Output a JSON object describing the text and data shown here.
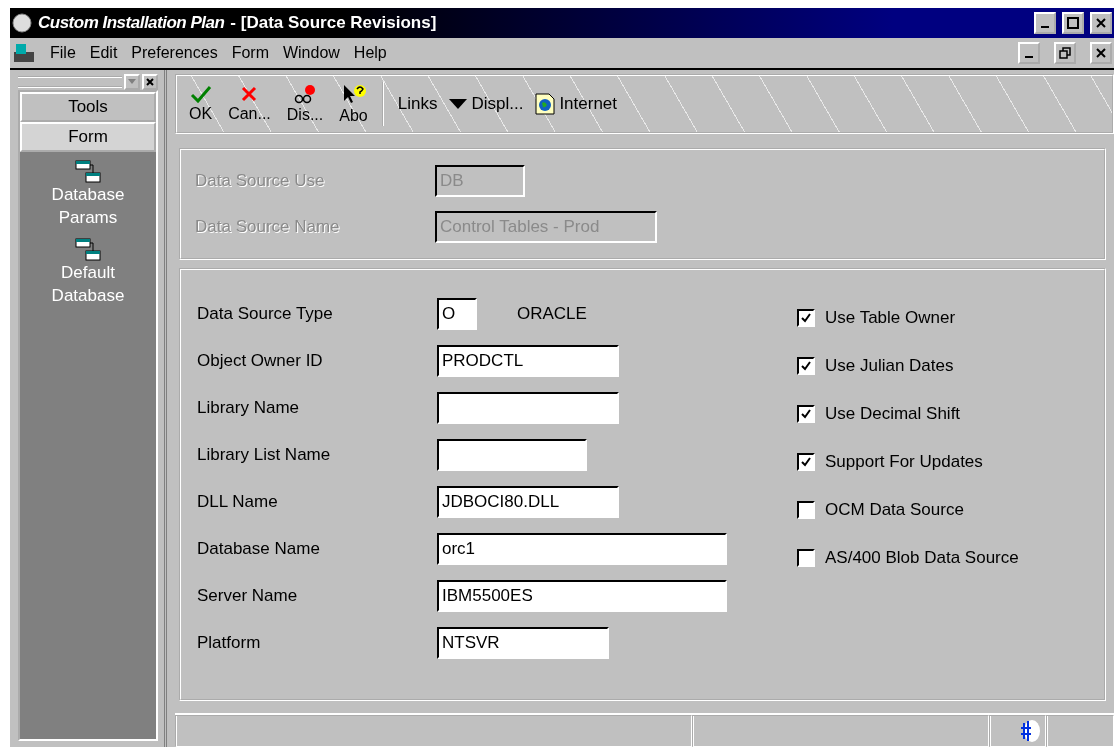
{
  "window": {
    "title_app": "Custom Installation Plan",
    "title_doc": "- [Data Source Revisions]"
  },
  "menu": [
    "File",
    "Edit",
    "Preferences",
    "Form",
    "Window",
    "Help"
  ],
  "sidebar": {
    "tabs": [
      {
        "label": "Tools",
        "selected": false
      },
      {
        "label": "Form",
        "selected": true
      }
    ],
    "items": [
      {
        "label": "Database Params"
      },
      {
        "label": "Default Database"
      }
    ]
  },
  "toolbar": {
    "buttons": [
      {
        "kind": "ok",
        "label": "OK"
      },
      {
        "kind": "cancel",
        "label": "Can..."
      },
      {
        "kind": "display",
        "label": "Dis..."
      },
      {
        "kind": "about",
        "label": "Abo"
      }
    ],
    "links": [
      {
        "kind": "text",
        "label": "Links"
      },
      {
        "kind": "dropdown",
        "label": "Displ..."
      },
      {
        "kind": "internet",
        "label": "Internet"
      }
    ]
  },
  "header_fields": [
    {
      "label": "Data Source Use",
      "value": "DB",
      "disabled": true
    },
    {
      "label": "Data Source Name",
      "value": "Control Tables - Prod",
      "disabled": true
    }
  ],
  "fields": [
    {
      "label": "Data Source Type",
      "value": "O",
      "description": "ORACLE",
      "disabled": false
    },
    {
      "label": "Object Owner ID",
      "value": "PRODCTL",
      "disabled": false
    },
    {
      "label": "Library Name",
      "disabled": false
    },
    {
      "label": "Library List Name",
      "disabled": false
    },
    {
      "label": "DLL Name",
      "value": "JDBOCI80.DLL",
      "disabled": false
    },
    {
      "label": "Database Name",
      "value": "orc1",
      "disabled": false
    },
    {
      "label": "Server Name",
      "value": "IBM5500ES",
      "disabled": false
    },
    {
      "label": "Platform",
      "value": "NTSVR",
      "disabled": false
    }
  ],
  "options": [
    {
      "label": "Use Table Owner",
      "checked": true
    },
    {
      "label": "Use Julian Dates",
      "checked": true
    },
    {
      "label": "Use Decimal Shift",
      "checked": true
    },
    {
      "label": "Support For Updates",
      "checked": true
    },
    {
      "label": "OCM Data Source",
      "checked": false
    },
    {
      "label": "AS/400 Blob Data Source",
      "checked": false
    }
  ]
}
